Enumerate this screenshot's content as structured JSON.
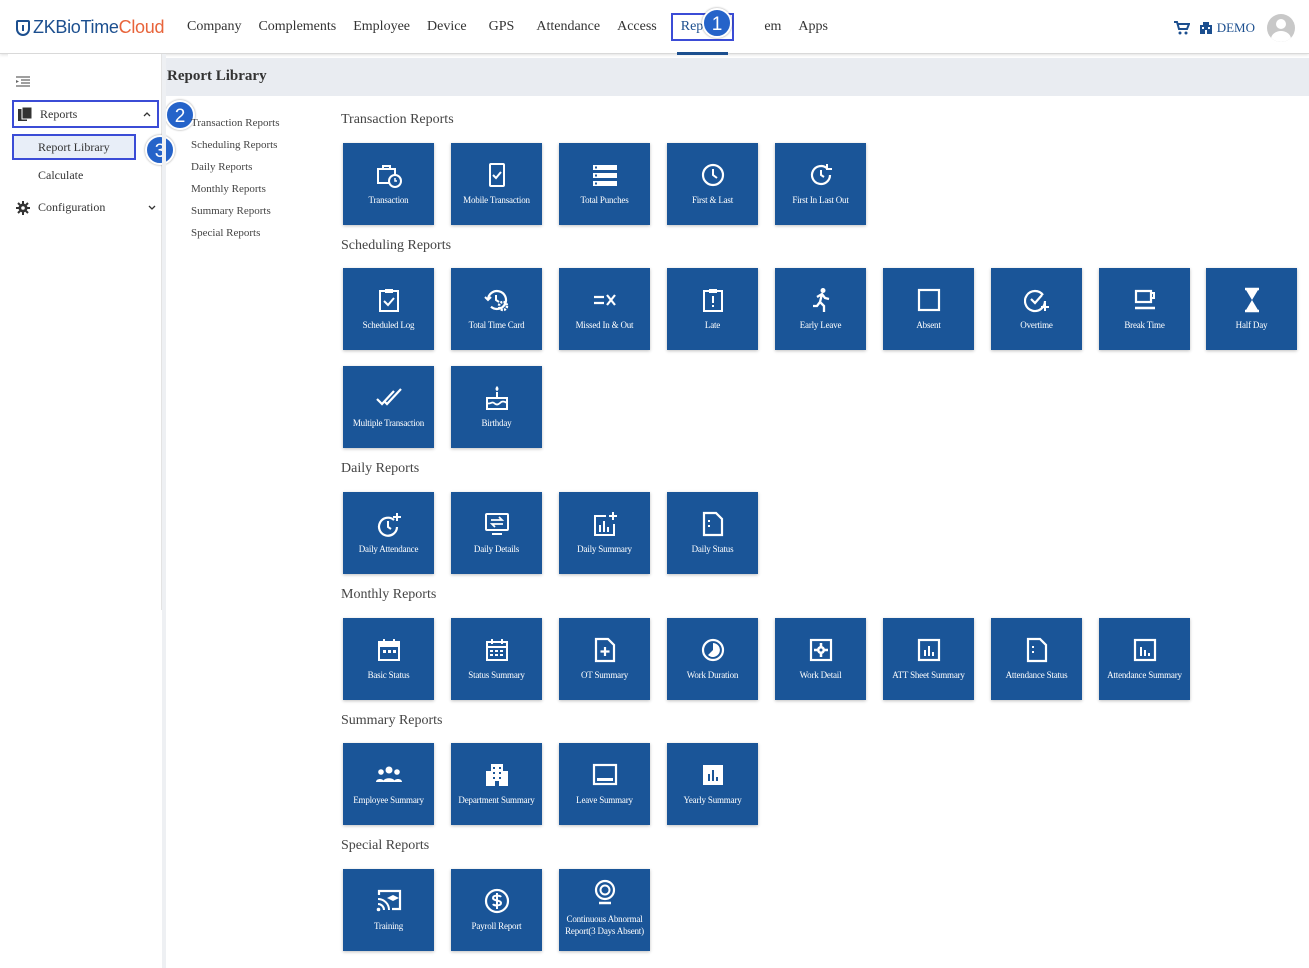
{
  "header": {
    "logo_main": "ZKBioTime",
    "logo_accent": "Cloud",
    "nav": [
      "Company",
      "Complements",
      "Employee",
      "Device",
      "GPS",
      "Attendance",
      "Access",
      "Reports",
      "em",
      "Apps"
    ],
    "user": "DEMO"
  },
  "badges": [
    "1",
    "2",
    "3"
  ],
  "sidebar": {
    "reports": "Reports",
    "report_library": "Report Library",
    "calculate": "Calculate",
    "configuration": "Configuration"
  },
  "page": {
    "title": "Report Library"
  },
  "categories": [
    "Transaction Reports",
    "Scheduling Reports",
    "Daily Reports",
    "Monthly Reports",
    "Summary Reports",
    "Special Reports"
  ],
  "sections": {
    "transaction": {
      "title": "Transaction Reports",
      "tiles": [
        "Transaction",
        "Mobile Transaction",
        "Total Punches",
        "First & Last",
        "First In Last Out"
      ]
    },
    "scheduling": {
      "title": "Scheduling Reports",
      "tiles": [
        "Scheduled Log",
        "Total Time Card",
        "Missed In & Out",
        "Late",
        "Early Leave",
        "Absent",
        "Overtime",
        "Break Time",
        "Half Day",
        "Multiple Transaction",
        "Birthday"
      ]
    },
    "daily": {
      "title": "Daily Reports",
      "tiles": [
        "Daily Attendance",
        "Daily Details",
        "Daily Summary",
        "Daily Status"
      ]
    },
    "monthly": {
      "title": "Monthly Reports",
      "tiles": [
        "Basic Status",
        "Status Summary",
        "OT Summary",
        "Work Duration",
        "Work Detail",
        "ATT Sheet Summary",
        "Attendance Status",
        "Attendance Summary"
      ]
    },
    "summary": {
      "title": "Summary Reports",
      "tiles": [
        "Employee Summary",
        "Department Summary",
        "Leave Summary",
        "Yearly Summary"
      ]
    },
    "special": {
      "title": "Special Reports",
      "tiles": [
        "Training",
        "Payroll Report",
        "Continuous Abnormal Report(3 Days Absent)"
      ]
    }
  },
  "colors": {
    "tile": "#1a5598",
    "highlight": "#3b4cd6",
    "badge": "#2563c9",
    "logo": "#1c4f8f",
    "logo_accent": "#e8643b"
  }
}
